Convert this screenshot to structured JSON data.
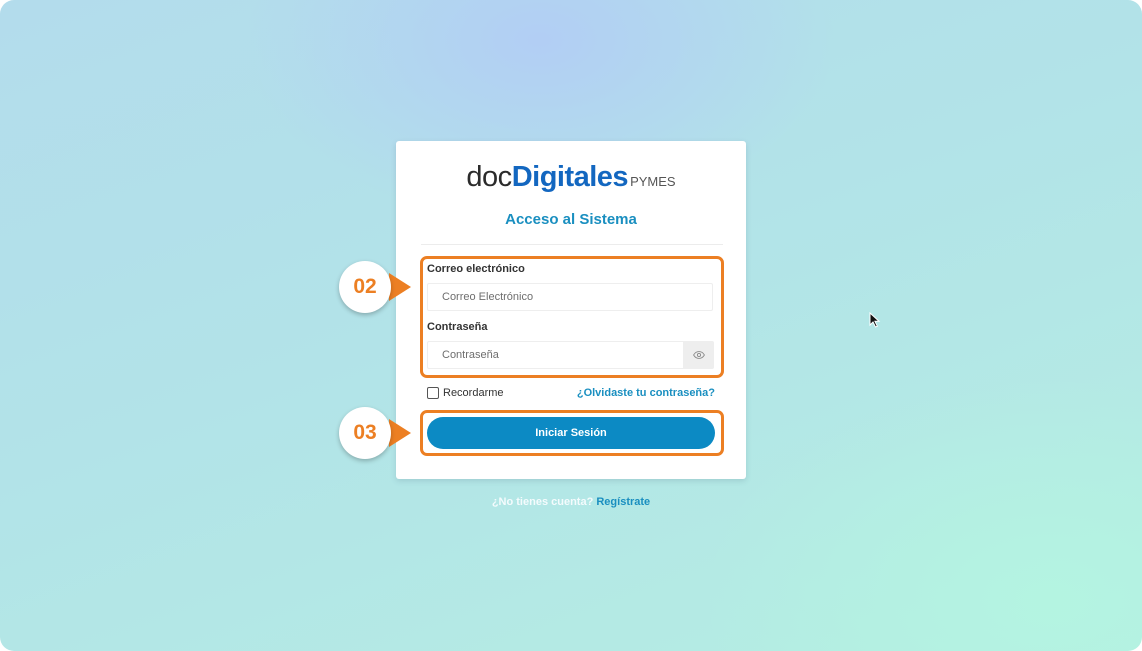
{
  "logo": {
    "part1": "doc",
    "part2": "Digitales",
    "part3": "PYMES"
  },
  "title": "Acceso al Sistema",
  "email": {
    "label": "Correo electrónico",
    "placeholder": "Correo Electrónico",
    "value": ""
  },
  "password": {
    "label": "Contraseña",
    "placeholder": "Contraseña",
    "value": "",
    "toggle_icon": "eye-icon"
  },
  "remember": {
    "label": "Recordarme",
    "checked": false
  },
  "forgot_link": "¿Olvidaste tu contraseña?",
  "submit_label": "Iniciar Sesión",
  "signup": {
    "question": "¿No tienes cuenta?",
    "link": "Regístrate"
  },
  "annotations": [
    {
      "number": "02"
    },
    {
      "number": "03"
    }
  ],
  "colors": {
    "brand_blue": "#1367c0",
    "accent_blue": "#1a8fc0",
    "button_blue": "#0c8ac4",
    "highlight_orange": "#ec7f23"
  }
}
